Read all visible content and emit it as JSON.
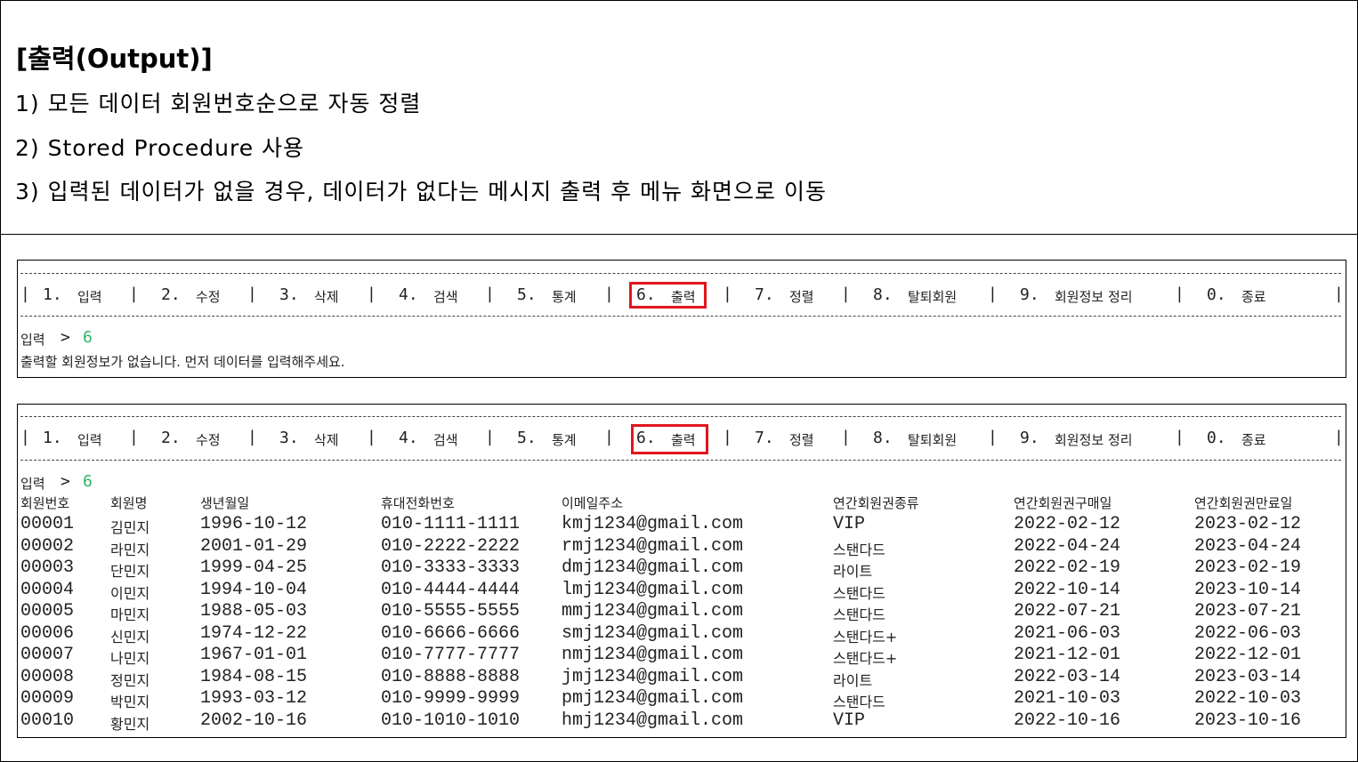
{
  "heading": "[출력(Output)]",
  "requirements": [
    "1) 모든 데이터 회원번호순으로 자동 정렬",
    "2) Stored Procedure 사용",
    "3) 입력된 데이터가 없을 경우, 데이터가 없다는 메시지 출력 후 메뉴 화면으로 이동"
  ],
  "menu": [
    {
      "num": "1.",
      "label": "입력"
    },
    {
      "num": "2.",
      "label": "수정"
    },
    {
      "num": "3.",
      "label": "삭제"
    },
    {
      "num": "4.",
      "label": "검색"
    },
    {
      "num": "5.",
      "label": "통계"
    },
    {
      "num": "6.",
      "label": "출력"
    },
    {
      "num": "7.",
      "label": "정렬"
    },
    {
      "num": "8.",
      "label": "탈퇴회원"
    },
    {
      "num": "9.",
      "label": "회원정보 정리"
    },
    {
      "num": "0.",
      "label": "종료"
    }
  ],
  "highlight_color": "#e0161e",
  "input_color": "#2fb26a",
  "console_empty": {
    "prompt_label": "입력",
    "prompt_symbol": ">",
    "prompt_value": "6",
    "message": "출력할 회원정보가 없습니다. 먼저 데이터를 입력해주세요."
  },
  "console_list": {
    "prompt_label": "입력",
    "prompt_symbol": ">",
    "prompt_value": "6",
    "columns": [
      "회원번호",
      "회원명",
      "생년월일",
      "휴대전화번호",
      "이메일주소",
      "연간회원권종류",
      "연간회원권구매일",
      "연간회원권만료일"
    ],
    "rows": [
      [
        "00001",
        "김민지",
        "1996-10-12",
        "010-1111-1111",
        "kmj1234@gmail.com",
        "VIP",
        "2022-02-12",
        "2023-02-12"
      ],
      [
        "00002",
        "라민지",
        "2001-01-29",
        "010-2222-2222",
        "rmj1234@gmail.com",
        "스탠다드",
        "2022-04-24",
        "2023-04-24"
      ],
      [
        "00003",
        "단민지",
        "1999-04-25",
        "010-3333-3333",
        "dmj1234@gmail.com",
        "라이트",
        "2022-02-19",
        "2023-02-19"
      ],
      [
        "00004",
        "이민지",
        "1994-10-04",
        "010-4444-4444",
        "lmj1234@gmail.com",
        "스탠다드",
        "2022-10-14",
        "2023-10-14"
      ],
      [
        "00005",
        "마민지",
        "1988-05-03",
        "010-5555-5555",
        "mmj1234@gmail.com",
        "스탠다드",
        "2022-07-21",
        "2023-07-21"
      ],
      [
        "00006",
        "신민지",
        "1974-12-22",
        "010-6666-6666",
        "smj1234@gmail.com",
        "스탠다드+",
        "2021-06-03",
        "2022-06-03"
      ],
      [
        "00007",
        "나민지",
        "1967-01-01",
        "010-7777-7777",
        "nmj1234@gmail.com",
        "스탠다드+",
        "2021-12-01",
        "2022-12-01"
      ],
      [
        "00008",
        "정민지",
        "1984-08-15",
        "010-8888-8888",
        "jmj1234@gmail.com",
        "라이트",
        "2022-03-14",
        "2023-03-14"
      ],
      [
        "00009",
        "박민지",
        "1993-03-12",
        "010-9999-9999",
        "pmj1234@gmail.com",
        "스탠다드",
        "2021-10-03",
        "2022-10-03"
      ],
      [
        "00010",
        "황민지",
        "2002-10-16",
        "010-1010-1010",
        "hmj1234@gmail.com",
        "VIP",
        "2022-10-16",
        "2023-10-16"
      ]
    ]
  }
}
